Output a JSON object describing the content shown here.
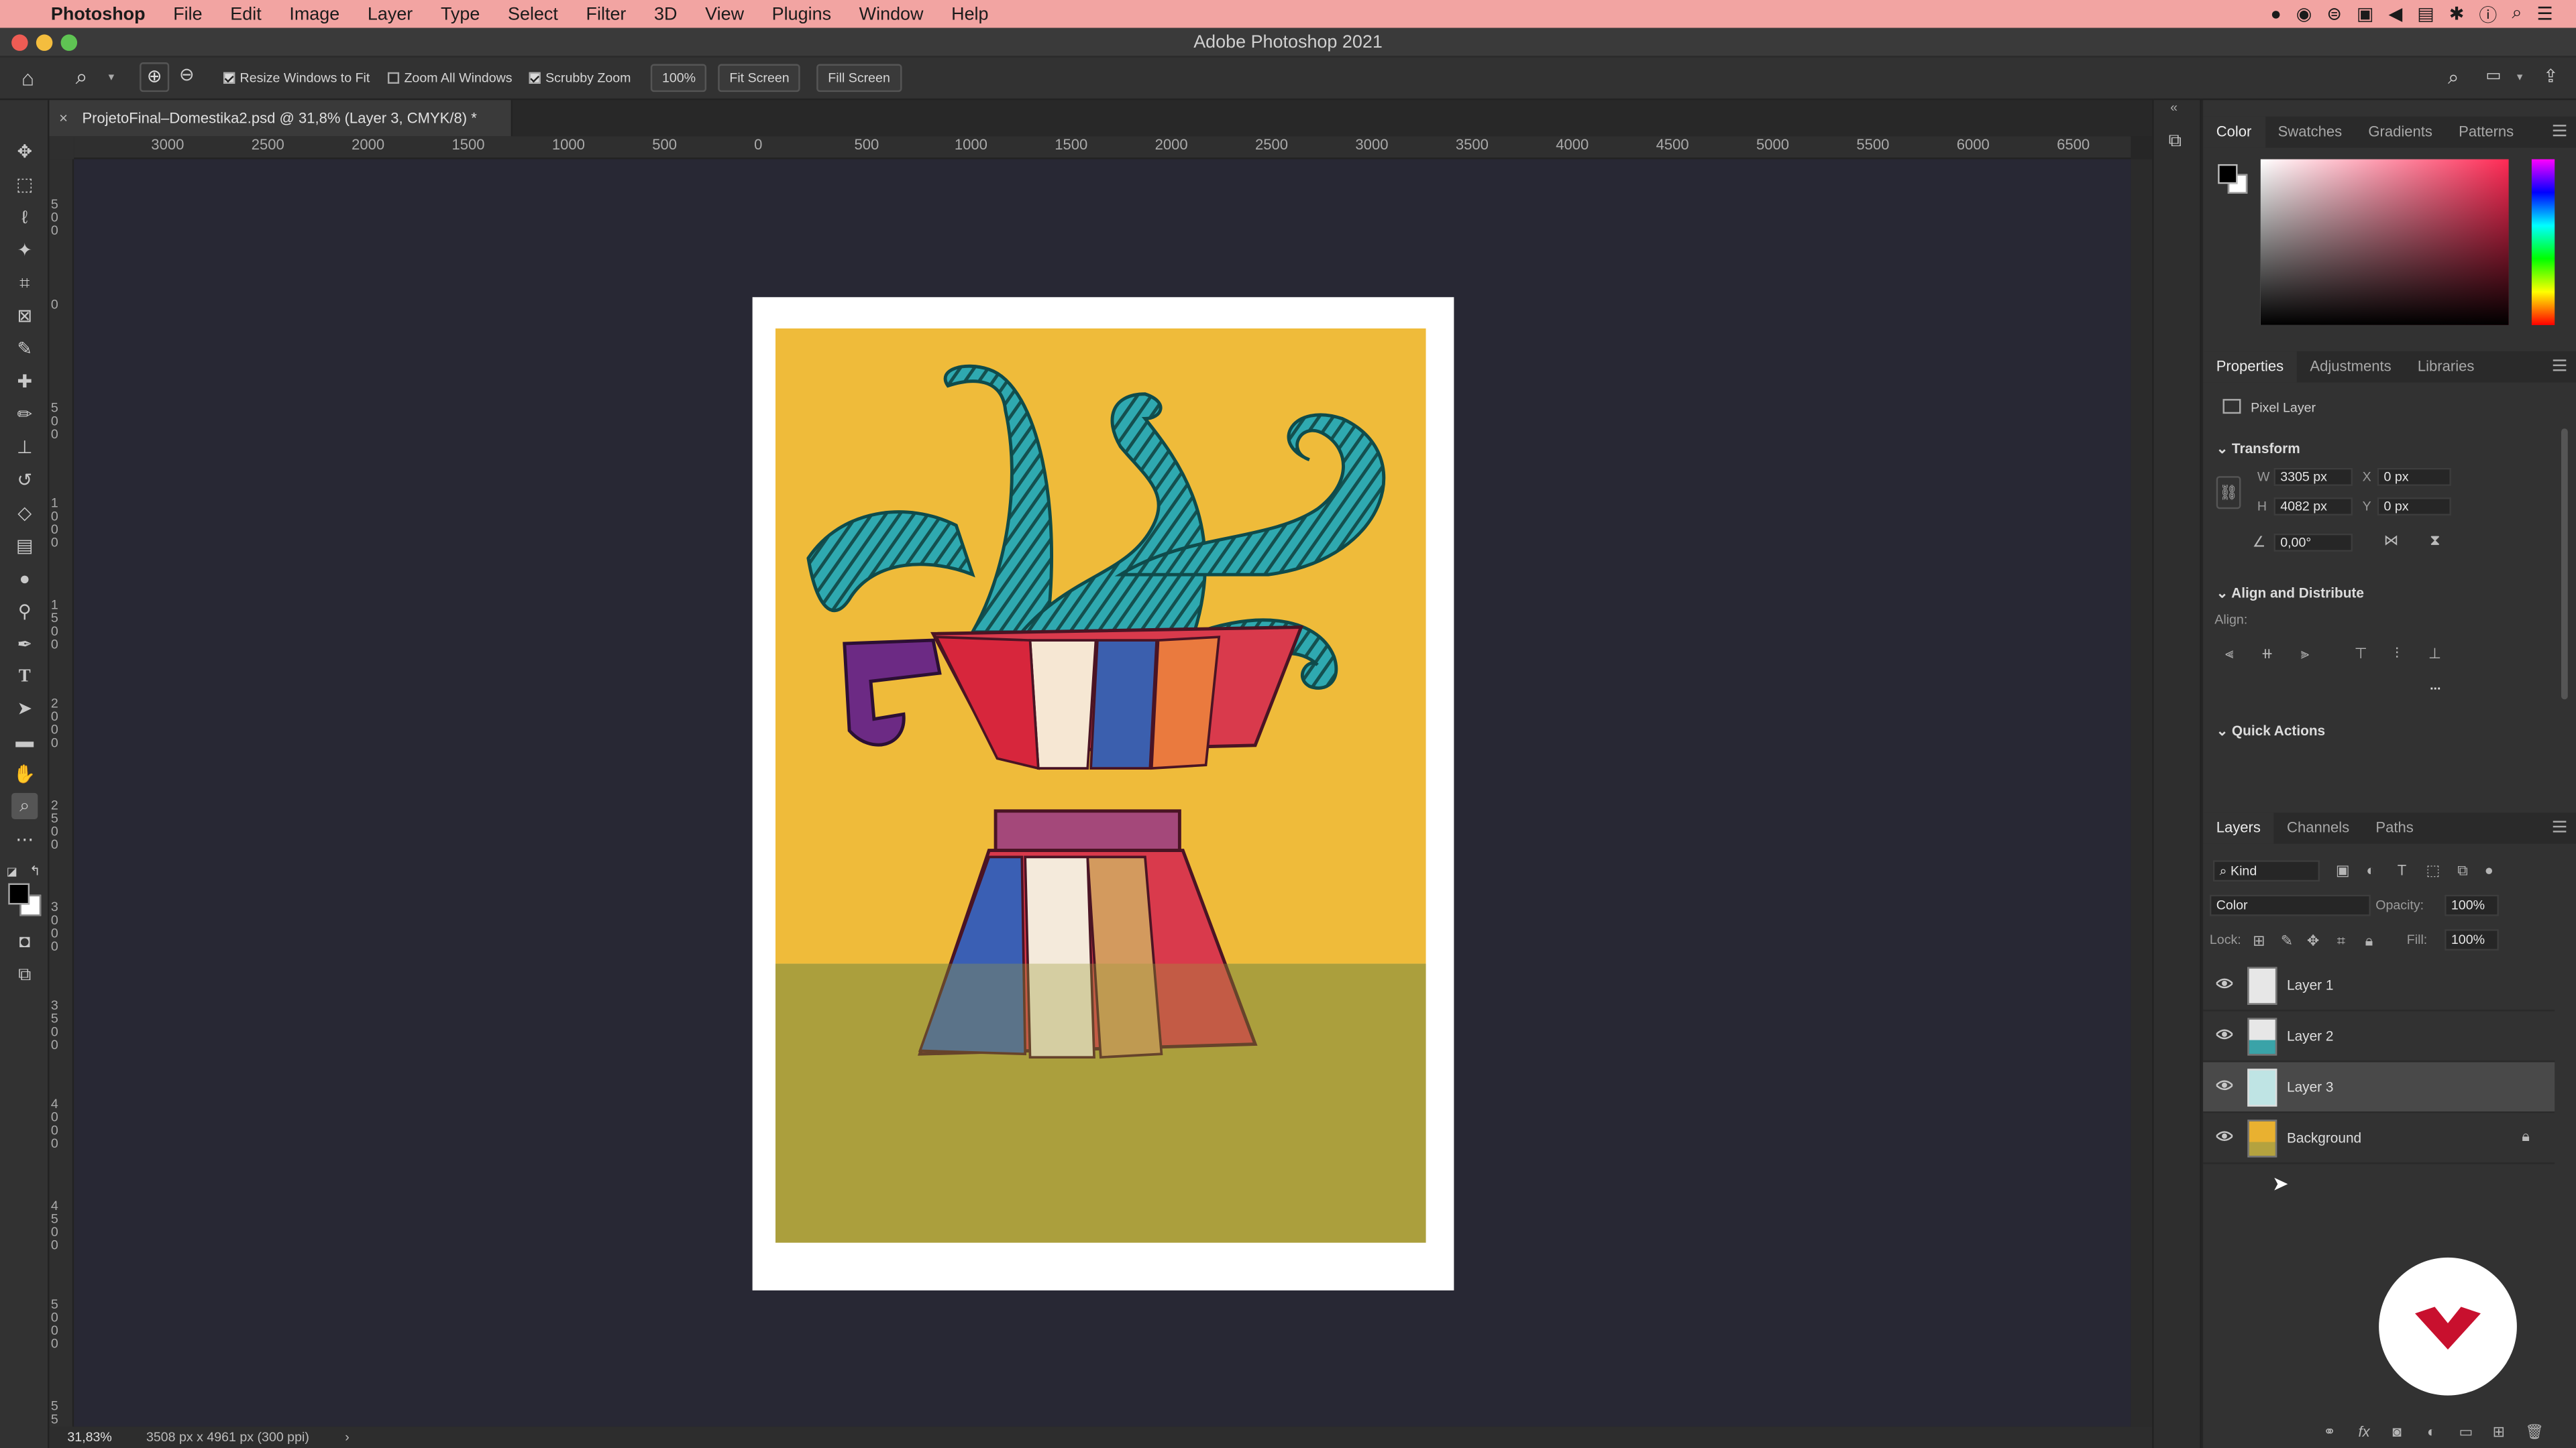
{
  "menubar": {
    "app": "Photoshop",
    "items": [
      "File",
      "Edit",
      "Image",
      "Layer",
      "Type",
      "Select",
      "Filter",
      "3D",
      "View",
      "Plugins",
      "Window",
      "Help"
    ]
  },
  "window": {
    "title": "Adobe Photoshop 2021"
  },
  "options": {
    "resize_windows": "Resize Windows to Fit",
    "zoom_all": "Zoom All Windows",
    "scrubby_zoom": "Scrubby Zoom",
    "zoom_value": "100%",
    "fit_screen": "Fit Screen",
    "fill_screen": "Fill Screen"
  },
  "document": {
    "tab_title": "ProjetoFinal–Domestika2.psd @ 31,8% (Layer 3, CMYK/8) *"
  },
  "ruler": {
    "h_ticks": [
      "3000",
      "2500",
      "2000",
      "1500",
      "1000",
      "500",
      "0",
      "500",
      "1000",
      "1500",
      "2000",
      "2500",
      "3000",
      "3500",
      "4000",
      "4500",
      "5000",
      "5500",
      "6000",
      "6500"
    ],
    "v_ticks": [
      "5 0 0",
      "0",
      "5 0 0",
      "1 0 0 0",
      "1 5 0 0",
      "2 0 0 0",
      "2 5 0 0",
      "3 0 0 0",
      "3 5 0 0",
      "4 0 0 0",
      "4 5 0 0",
      "5 0 0 0",
      "5 5"
    ]
  },
  "status": {
    "zoom": "31,83%",
    "doc_info": "3508 px x 4961 px (300 ppi)"
  },
  "color_panel": {
    "tabs": [
      "Color",
      "Swatches",
      "Gradients",
      "Patterns"
    ],
    "active_tab": "Color",
    "field_top_color": "#ff2a55"
  },
  "properties_panel": {
    "tabs": [
      "Properties",
      "Adjustments",
      "Libraries"
    ],
    "layer_kind": "Pixel Layer",
    "transform_title": "Transform",
    "w_label": "W",
    "w_value": "3305 px",
    "h_label": "H",
    "h_value": "4082 px",
    "x_label": "X",
    "x_value": "0 px",
    "y_label": "Y",
    "y_value": "0 px",
    "angle_value": "0,00°",
    "align_title": "Align and Distribute",
    "align_label": "Align:",
    "more": "...",
    "quick_actions": "Quick Actions"
  },
  "layers_panel": {
    "tabs": [
      "Layers",
      "Channels",
      "Paths"
    ],
    "kind_label": "Kind",
    "blend_mode": "Color",
    "opacity_label": "Opacity:",
    "opacity_value": "100%",
    "lock_label": "Lock:",
    "fill_label": "Fill:",
    "fill_value": "100%",
    "layers": [
      {
        "name": "Layer 1",
        "visible": true,
        "selected": false,
        "thumb": "#e7e7e7"
      },
      {
        "name": "Layer 2",
        "visible": true,
        "selected": false,
        "thumb": "#3aa3a8"
      },
      {
        "name": "Layer 3",
        "visible": true,
        "selected": true,
        "thumb": "#bfe4e4"
      },
      {
        "name": "Background",
        "visible": true,
        "selected": false,
        "thumb": "#e9b130",
        "locked": true
      }
    ]
  },
  "colors": {
    "menubar_bg": "#f2a4a2",
    "artwork_yellow": "#f0bd3a",
    "artwork_olive": "#b5a341",
    "tentacle_teal": "#2eaab1",
    "watermark_red": "#c8102e"
  }
}
